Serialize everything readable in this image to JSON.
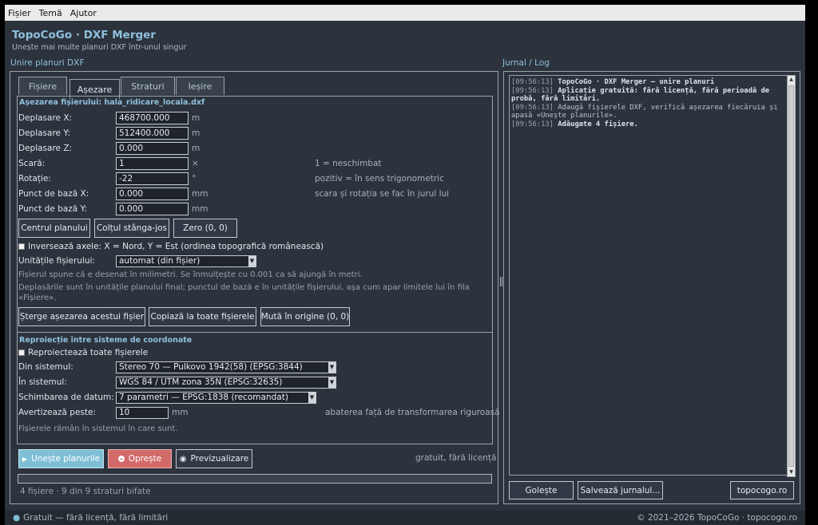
{
  "menu": [
    "Fișier",
    "Temă",
    "Ajutor"
  ],
  "app": {
    "title": "TopoCoGo · DXF Merger",
    "subtitle": "Unește mai multe planuri DXF într-unul singur"
  },
  "left_section_label": "Unire planuri DXF",
  "right_section_label": "Jurnal / Log",
  "tabs": [
    {
      "label": "Fișiere",
      "active": false
    },
    {
      "label": "Așezare",
      "active": true
    },
    {
      "label": "Straturi",
      "active": false
    },
    {
      "label": "Ieșire",
      "active": false
    }
  ],
  "placement": {
    "heading": "Așezarea fișierului: hala_ridicare_locala.dxf",
    "fields": [
      {
        "label": "Deplasare X:",
        "value": "468700.000",
        "unit": "m",
        "hint": ""
      },
      {
        "label": "Deplasare Y:",
        "value": "512400.000",
        "unit": "m",
        "hint": ""
      },
      {
        "label": "Deplasare Z:",
        "value": "0.000",
        "unit": "m",
        "hint": ""
      },
      {
        "label": "Scară:",
        "value": "1",
        "unit": "×",
        "hint": "1 = neschimbat"
      },
      {
        "label": "Rotație:",
        "value": "-22",
        "unit": "°",
        "hint": "pozitiv = în sens trigonometric"
      },
      {
        "label": "Punct de bază X:",
        "value": "0.000",
        "unit": "mm",
        "hint": "scara și rotația se fac în jurul lui"
      },
      {
        "label": "Punct de bază Y:",
        "value": "0.000",
        "unit": "mm",
        "hint": ""
      }
    ],
    "base_buttons": [
      "Centrul planului",
      "Colțul stânga-jos",
      "Zero (0, 0)"
    ],
    "invert_axes_label": "Inversează axele: X = Nord, Y = Est (ordinea topografică românească)",
    "units_label": "Unitățile fișierului:",
    "units_value": "automat (din fișier)",
    "note1": "Fișierul spune că e desenat în milimetri. Se înmulțește cu 0.001 ca să ajungă în metri.",
    "note2": "Deplasările sunt în unitățile planului final; punctul de bază e în unitățile fișierului, așa cum apar limitele lui în fila «Fișiere».",
    "action_buttons": [
      "Șterge așezarea acestui fișier",
      "Copiază la toate fișierele",
      "Mută în origine (0, 0)"
    ]
  },
  "reproject": {
    "heading": "Reproiecție între sisteme de coordonate",
    "checkbox_label": "Reproiectează toate fișierele",
    "from_label": "Din sistemul:",
    "from_value": "Stereo 70 — Pulkovo 1942(58) (EPSG:3844)",
    "to_label": "În sistemul:",
    "to_value": "WGS 84 / UTM zona 35N (EPSG:32635)",
    "datum_label": "Schimbarea de datum:",
    "datum_value": "7 parametri — EPSG:1838 (recomandat)",
    "warn_label": "Avertizează peste:",
    "warn_value": "10",
    "warn_unit": "mm",
    "warn_hint": "abaterea față de transformarea riguroasă",
    "note": "Fișierele rămân în sistemul în care sunt."
  },
  "run": {
    "merge": "Unește planurile",
    "stop": "Oprește",
    "preview": "Previzualizare",
    "license": "gratuit, fără licență",
    "progress": 0,
    "status": "4 fișiere  ·  9 din 9 straturi bifate"
  },
  "log": {
    "lines": [
      {
        "ts": "[09:56:13]",
        "text": "TopoCoGo · DXF Merger — unire planuri",
        "bold": true
      },
      {
        "ts": "[09:56:13]",
        "text": "Aplicație gratuită: fără licență, fără perioadă de probă, fără limitări.",
        "bold": true
      },
      {
        "ts": "[09:56:13]",
        "text": "Adaugă fișierele DXF, verifică așezarea fiecăruia și apasă «Unește planurile».",
        "bold": false
      },
      {
        "ts": "[09:56:13]",
        "text": "Adăugate 4 fișiere.",
        "bold": true
      }
    ],
    "buttons": [
      "Golește",
      "Salvează jurnalul...",
      "topocogo.ro"
    ]
  },
  "statusbar": {
    "left": "Gratuit — fără licență, fără limitări",
    "right": "© 2021–2026 TopoCoGo · topocogo.ro"
  },
  "colors": {
    "accent": "#8fc0dc",
    "run": "#7fbfd6",
    "stop": "#d26a6a",
    "background": "#2c333d"
  }
}
